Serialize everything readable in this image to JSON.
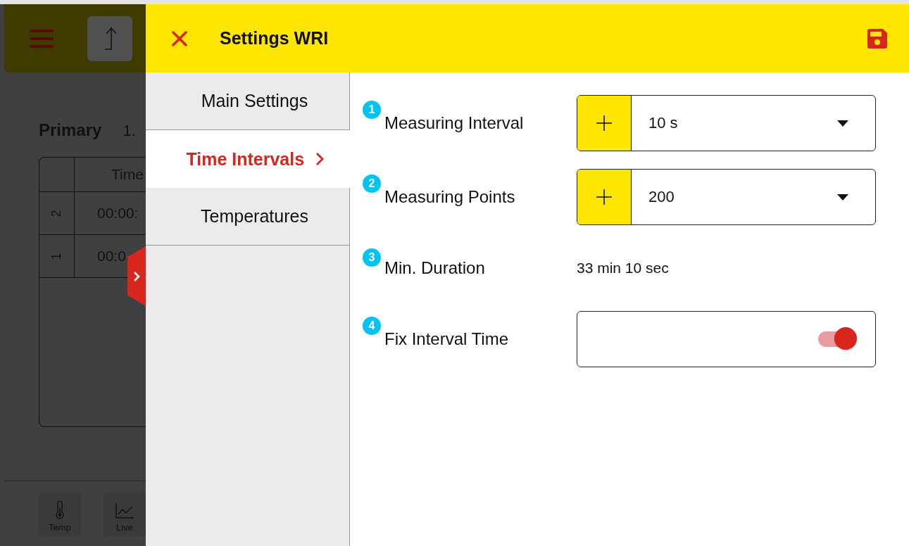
{
  "background_app": {
    "primary_label": "Primary",
    "primary_value": "1.",
    "table": {
      "columns": [
        "Time"
      ],
      "rows": [
        {
          "index": "2",
          "time": "00:00:"
        },
        {
          "index": "1",
          "time": "00:0"
        }
      ]
    },
    "bottom_nav": [
      {
        "label": "Temp",
        "kind": "thermometer"
      },
      {
        "label": "Live",
        "kind": "chart"
      }
    ]
  },
  "dialog": {
    "title": "Settings WRI",
    "nav": [
      {
        "label": "Main Settings",
        "selected": false
      },
      {
        "label": "Time Intervals",
        "selected": true
      },
      {
        "label": "Temperatures",
        "selected": false
      }
    ],
    "settings": [
      {
        "number": "1",
        "label": "Measuring Interval",
        "kind": "select",
        "value": "10 s"
      },
      {
        "number": "2",
        "label": "Measuring Points",
        "kind": "select",
        "value": "200"
      },
      {
        "number": "3",
        "label": "Min. Duration",
        "kind": "text",
        "value": "33 min 10 sec"
      },
      {
        "number": "4",
        "label": "Fix Interval Time",
        "kind": "toggle",
        "on": true
      }
    ]
  }
}
